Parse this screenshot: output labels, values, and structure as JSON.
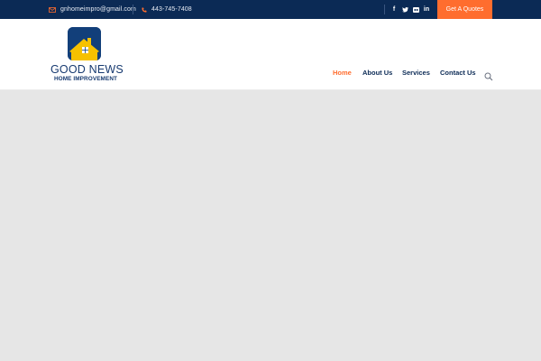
{
  "topbar": {
    "email": "gnhomeimpro@gmail.com",
    "phone": "443-745-7408",
    "social_icons": [
      "facebook-icon",
      "twitter-icon",
      "flickr-icon",
      "linkedin-icon"
    ],
    "social_glyphs": [
      "f",
      "🐦",
      "▪",
      "in"
    ],
    "quote_label": "Get A Quotes"
  },
  "logo": {
    "title": "GOOD NEWS",
    "subtitle": "HOME IMPROVEMENT"
  },
  "nav": {
    "items": [
      {
        "label": "Home",
        "active": true
      },
      {
        "label": "About Us",
        "active": false
      },
      {
        "label": "Services",
        "active": false
      },
      {
        "label": "Contact Us",
        "active": false
      }
    ]
  },
  "colors": {
    "topbar_bg": "#0b2a55",
    "accent": "#ff6d2e",
    "nav_text": "#0b2a55",
    "content_bg": "#e6e6e6",
    "logo_blue": "#123f7a",
    "logo_yellow": "#f6c100"
  }
}
